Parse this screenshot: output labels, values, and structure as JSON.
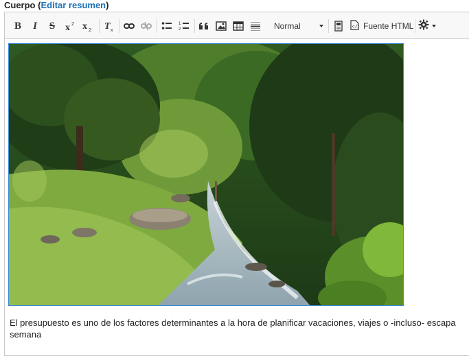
{
  "field": {
    "label": "Cuerpo",
    "open_paren": "(",
    "link": "Editar resumen",
    "close_paren": ")"
  },
  "toolbar": {
    "bold_icon": "bold-icon",
    "italic_icon": "italic-icon",
    "strike_icon": "strikethrough-icon",
    "superscript_icon": "superscript-icon",
    "subscript_icon": "subscript-icon",
    "remove_format_icon": "remove-format-icon",
    "link_icon": "link-icon",
    "unlink_icon": "unlink-icon",
    "bullet_list_icon": "bulleted-list-icon",
    "numbered_list_icon": "numbered-list-icon",
    "blockquote_icon": "blockquote-icon",
    "image_icon": "image-icon",
    "table_icon": "table-icon",
    "hr_icon": "horizontal-rule-icon",
    "format_value": "Normal",
    "show_blocks_icon": "show-blocks-icon",
    "source_label": "Fuente HTML",
    "settings_icon": "gear-icon"
  },
  "content": {
    "image_subject": "mountain river with green forest",
    "paragraph_line1": "El presupuesto es uno de los factores determinantes a la hora de planificar vacaciones, viajes o -incluso- escapa",
    "paragraph_line2": "semana"
  },
  "colors": {
    "link": "#1a6fb7",
    "image_border": "#3b8bd6",
    "toolbar_bg": "#f8f8f8"
  }
}
